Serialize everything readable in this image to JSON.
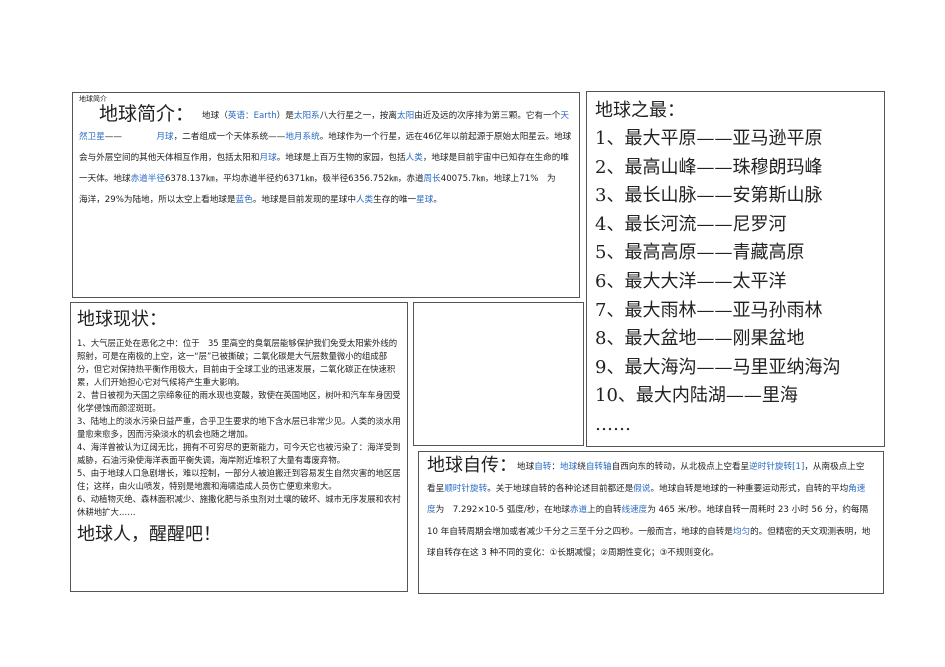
{
  "intro": {
    "tag": "地球简介",
    "title": "地球简介：",
    "segments": [
      {
        "t": "地球（",
        "c": ""
      },
      {
        "t": "英语：Earth",
        "c": "blue"
      },
      {
        "t": "）是",
        "c": ""
      },
      {
        "t": "太阳系",
        "c": "blue"
      },
      {
        "t": "八大行星之一，按离",
        "c": ""
      },
      {
        "t": "太阳",
        "c": "blue"
      },
      {
        "t": "由近及远的次序排为第三颗。它有一个",
        "c": ""
      },
      {
        "t": "天然卫星",
        "c": "blue"
      },
      {
        "t": "——　　　　",
        "c": ""
      },
      {
        "t": "月球",
        "c": "blue"
      },
      {
        "t": "，二者组成一个天体系统——",
        "c": ""
      },
      {
        "t": "地月系统",
        "c": "blue"
      },
      {
        "t": "。地球作为一个行星，远在46亿年以前起源于原始太阳星云。地球会与外层空间的其他天体相互作用，包括太阳和",
        "c": ""
      },
      {
        "t": "月球",
        "c": "blue"
      },
      {
        "t": "。地球是上百万生物的家园，包括",
        "c": ""
      },
      {
        "t": "人类",
        "c": "blue"
      },
      {
        "t": "，地球是目前宇宙中已知存在生命的唯一天体。地球",
        "c": ""
      },
      {
        "t": "赤道半径",
        "c": "blue"
      },
      {
        "t": "6378.137㎞，平均赤道半径约6371㎞，极半径6356.752㎞，赤道",
        "c": ""
      },
      {
        "t": "周长",
        "c": "blue"
      },
      {
        "t": "40075.7㎞，地球上71%　为　　海洋，29%为陆地，所以太空上看地球是",
        "c": ""
      },
      {
        "t": "蓝色",
        "c": "blue"
      },
      {
        "t": "。地球是目前发现的星球中",
        "c": ""
      },
      {
        "t": "人类",
        "c": "blue"
      },
      {
        "t": "生存的唯一",
        "c": ""
      },
      {
        "t": "星球",
        "c": "blue"
      },
      {
        "t": "。",
        "c": ""
      }
    ]
  },
  "status": {
    "title": "地球现状：",
    "items": [
      "1、大气层正处在恶化之中：位于　35 里高空的臭氧层能够保护我们免受太阳紫外线的照射，可是在南极的上空，这一“层”已被撕破；二氧化碳是大气层数量微小的组成部分，但它对保持热平衡作用极大，目前由于全球工业的迅速发展，二氧化碳正在快速积累，人们开始担心它对气候将产生重大影响。",
      "2、昔日被视为天国之宗缔象征的雨水现也变酸，致使在英国地区，树叶和汽车车身因受化学侵蚀而颜涩斑斑。",
      "3、陆地上的淡水污染日益严重，合乎卫生要求的地下含水层已非常少见。人类的淡水用量愈来愈多，因而污染淡水的机会也随之增加。",
      "4、海洋曾被认为辽阔无比，拥有不可穷尽的更新能力，可今天它也被污染了：海洋受到威胁，石油污染使海洋表面平衡失调，海岸附近堆积了大量有毒废弃物。",
      "5、由于地球人口急剧增长，难以控制，一部分人被迫搬迁到容易发生自然灾害的地区居住；这样，由火山喷发，特别是地震和海啸造成人员伤亡便愈来愈大。",
      "6、动植物灭绝、森林面积减少、施撒化肥与杀虫剂对土壤的破坏、城市无序发展和农村休耕地扩大……"
    ],
    "slogan": "地球人，醒醒吧！"
  },
  "records": {
    "title": "地球之最：",
    "items": [
      "1、最大平原——亚马逊平原",
      "2、最高山峰——珠穆朗玛峰",
      "3、最长山脉——安第斯山脉",
      "4、最长河流——尼罗河",
      "5、最高高原——青藏高原",
      "6、最大大洋——太平洋",
      "7、最大雨林——亚马孙雨林",
      "8、最大盆地——刚果盆地",
      "9、最大海沟——马里亚纳海沟",
      "10、最大内陆湖——里海",
      "……"
    ]
  },
  "rotation": {
    "title": "地球自传：",
    "segments": [
      {
        "t": "地球",
        "c": ""
      },
      {
        "t": "自转",
        "c": "blue"
      },
      {
        "t": "：",
        "c": ""
      },
      {
        "t": "地球",
        "c": "blue"
      },
      {
        "t": "绕",
        "c": ""
      },
      {
        "t": "自转轴",
        "c": "blue"
      },
      {
        "t": "自西向东的转动，从北极点上空看呈",
        "c": ""
      },
      {
        "t": "逆时针旋转",
        "c": "blue"
      },
      {
        "t": "[1]",
        "c": "blue"
      },
      {
        "t": "，从南极点上空看呈",
        "c": ""
      },
      {
        "t": "顺时针旋转",
        "c": "blue"
      },
      {
        "t": "。关于地球自转的各种论述目前都还是",
        "c": ""
      },
      {
        "t": "假说",
        "c": "blue"
      },
      {
        "t": "。地球自转是地球的一种重要运动形式，自转的平均",
        "c": ""
      },
      {
        "t": "角速度",
        "c": "blue"
      },
      {
        "t": "为　7.292×10-5 弧度/秒，在地球",
        "c": ""
      },
      {
        "t": "赤道",
        "c": "blue"
      },
      {
        "t": "上的自转",
        "c": ""
      },
      {
        "t": "线速度",
        "c": "blue"
      },
      {
        "t": "为 465 米/秒。地球自转一周耗时 23 小时 56 分，约每隔 10 年自转周期会增加或者减少千分之三至千分之四秒。一般而言，地球的自转是",
        "c": ""
      },
      {
        "t": "均匀",
        "c": "blue"
      },
      {
        "t": "的。但精密的天文观测表明，地球自转存在这 3 种不同的变化：①长期减慢；②周期性变化；③不规则变化。",
        "c": ""
      }
    ]
  }
}
